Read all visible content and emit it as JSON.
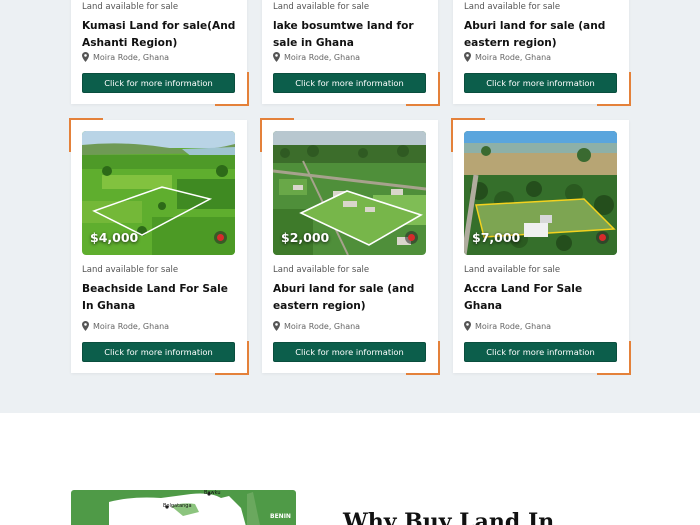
{
  "colors": {
    "accent": "#e4813a",
    "button": "#0c5e4b",
    "section_bg": "#ecf0f3"
  },
  "top_cards": [
    {
      "type": "Land available for sale",
      "title": "Kumasi Land for sale(And Ashanti Region)",
      "location": "Moira Rode, Ghana",
      "button": "Click for more information"
    },
    {
      "type": "Land available for sale",
      "title": "lake bosumtwe land for sale in Ghana",
      "location": "Moira Rode, Ghana",
      "button": "Click for more information"
    },
    {
      "type": "Land available for sale",
      "title": "Aburi land for sale (and eastern region)",
      "location": "Moira Rode, Ghana",
      "button": "Click for more information"
    }
  ],
  "bottom_cards": [
    {
      "price": "$4,000",
      "type": "Land available for sale",
      "title": "Beachside Land For Sale In Ghana",
      "location": "Moira Rode, Ghana",
      "button": "Click for more information"
    },
    {
      "price": "$2,000",
      "type": "Land available for sale",
      "title": "Aburi land for sale (and eastern region)",
      "location": "Moira Rode, Ghana",
      "button": "Click for more information"
    },
    {
      "price": "$7,000",
      "type": "Land available for sale",
      "title": "Accra Land For Sale Ghana",
      "location": "Moira Rode, Ghana",
      "button": "Click for more information"
    }
  ],
  "map": {
    "labels": [
      "Bawku",
      "Bolgatanga",
      "BENIN"
    ]
  },
  "why": {
    "heading": "Why Buy Land In"
  },
  "icons": {
    "location": "map-pin-icon",
    "favourite": "pin-dot-icon"
  }
}
